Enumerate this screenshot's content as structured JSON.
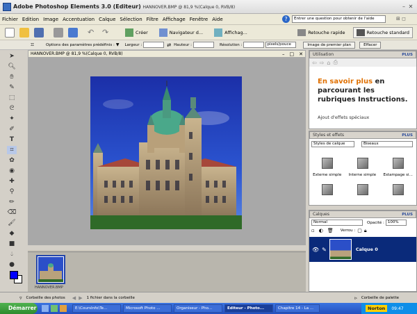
{
  "window": {
    "title": "Adobe Photoshop Elements 3.0 (Editeur)",
    "doc_info": "HANNOVER.BMP @ 81,9 %(Calque 0, RVB/8)"
  },
  "menu": [
    "Fichier",
    "Edition",
    "Image",
    "Accentuation",
    "Calque",
    "Sélection",
    "Filtre",
    "Affichage",
    "Fenêtre",
    "Aide"
  ],
  "help_placeholder": "Entrer une question pour obtenir de l'aide",
  "toolbar": {
    "create": "Créer",
    "browser": "Navigateur d...",
    "view": "Affichag...",
    "quick_fix": "Retouche rapide",
    "standard_edit": "Retouche standard"
  },
  "options": {
    "presets": "Options des paramètres prédéfinis :",
    "width": "Largeur :",
    "height": "Hauteur :",
    "resolution": "Résolution :",
    "unit": "pixels/pouce",
    "front_image": "Image de premier plan",
    "clear": "Effacer"
  },
  "document": {
    "title": "HANNOVER.BMP @ 81,9 %(Calque 0, RVB/8)"
  },
  "photo_bin": {
    "thumb_label": "HANNOVER.BMP",
    "bin_label": "Corbeille des photos",
    "file_count": "1 fichier dans la corbeille"
  },
  "palettes": {
    "utilisation": {
      "title": "Utilisation",
      "plus": "PLUS",
      "headline_orange": "En savoir plus",
      "headline_rest": " en parcourant les rubriques Instructions.",
      "link": "Ajout d'effets spéciaux"
    },
    "styles": {
      "title": "Styles et effets",
      "plus": "PLUS",
      "category": "Styles de calque",
      "subcategory": "Biseaux",
      "items": [
        "Externe simple",
        "Interne simple",
        "Estampage si..."
      ]
    },
    "layers": {
      "title": "Calques",
      "plus": "PLUS",
      "blend_mode": "Normal",
      "opacity_label": "Opacité :",
      "opacity_value": "100%",
      "lock_label": "Verrou :",
      "layer_name": "Calque 0"
    },
    "palette_bin_label": "Corbeille de palette"
  },
  "taskbar": {
    "start": "Démarrer",
    "tasks": [
      "E:\\CoursInfo\\Te...",
      "Microsoft Photo ...",
      "Organiseur - Pho...",
      "Editeur - Photo...",
      "Chapitre 14 - La ..."
    ],
    "active_index": 3,
    "norton": "Norton",
    "clock": "09:47"
  }
}
